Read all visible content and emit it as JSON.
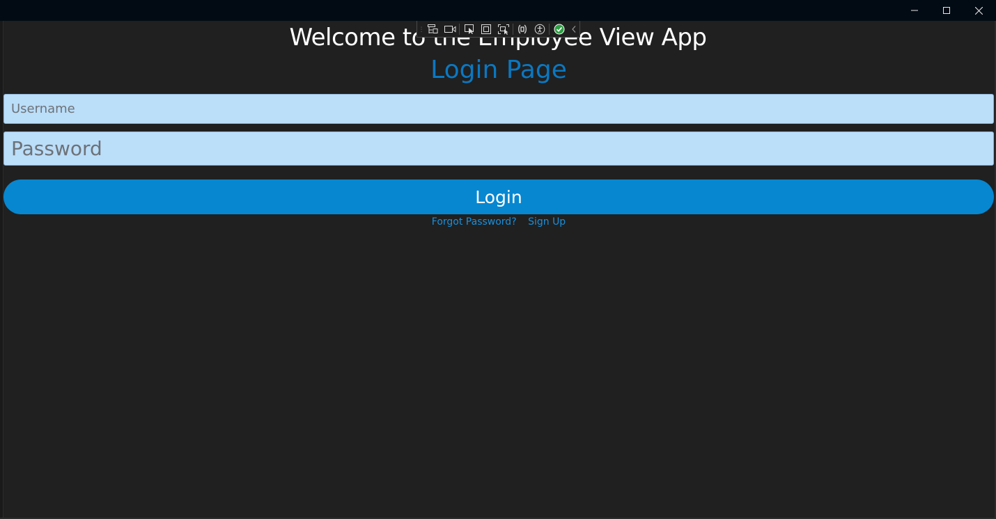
{
  "window": {
    "caption_buttons": {
      "minimize_icon": "minimize-icon",
      "maximize_icon": "maximize-icon",
      "close_icon": "close-icon"
    }
  },
  "header": {
    "welcome": "Welcome to the Employee View App",
    "page_title": "Login Page"
  },
  "form": {
    "username": {
      "value": "",
      "placeholder": "Username"
    },
    "password": {
      "value": "",
      "placeholder": "Password"
    },
    "login_label": "Login"
  },
  "links": {
    "forgot_password": "Forgot Password?",
    "sign_up": "Sign Up"
  },
  "debug_toolbar": {
    "icons": [
      "live-visual-tree-icon",
      "record-icon",
      "select-element-icon",
      "display-layout-adorners-icon",
      "track-focus-icon",
      "binding-failures-icon",
      "accessibility-icon",
      "status-ok-icon",
      "collapse-chevron-icon"
    ]
  },
  "colors": {
    "window_bg": "#202020",
    "titlebar_bg": "#020b14",
    "accent": "#0787d0",
    "title_blue": "#0a78c2",
    "input_bg": "#bbdef9",
    "link": "#1b8fd9",
    "ok_green": "#2ea043"
  }
}
